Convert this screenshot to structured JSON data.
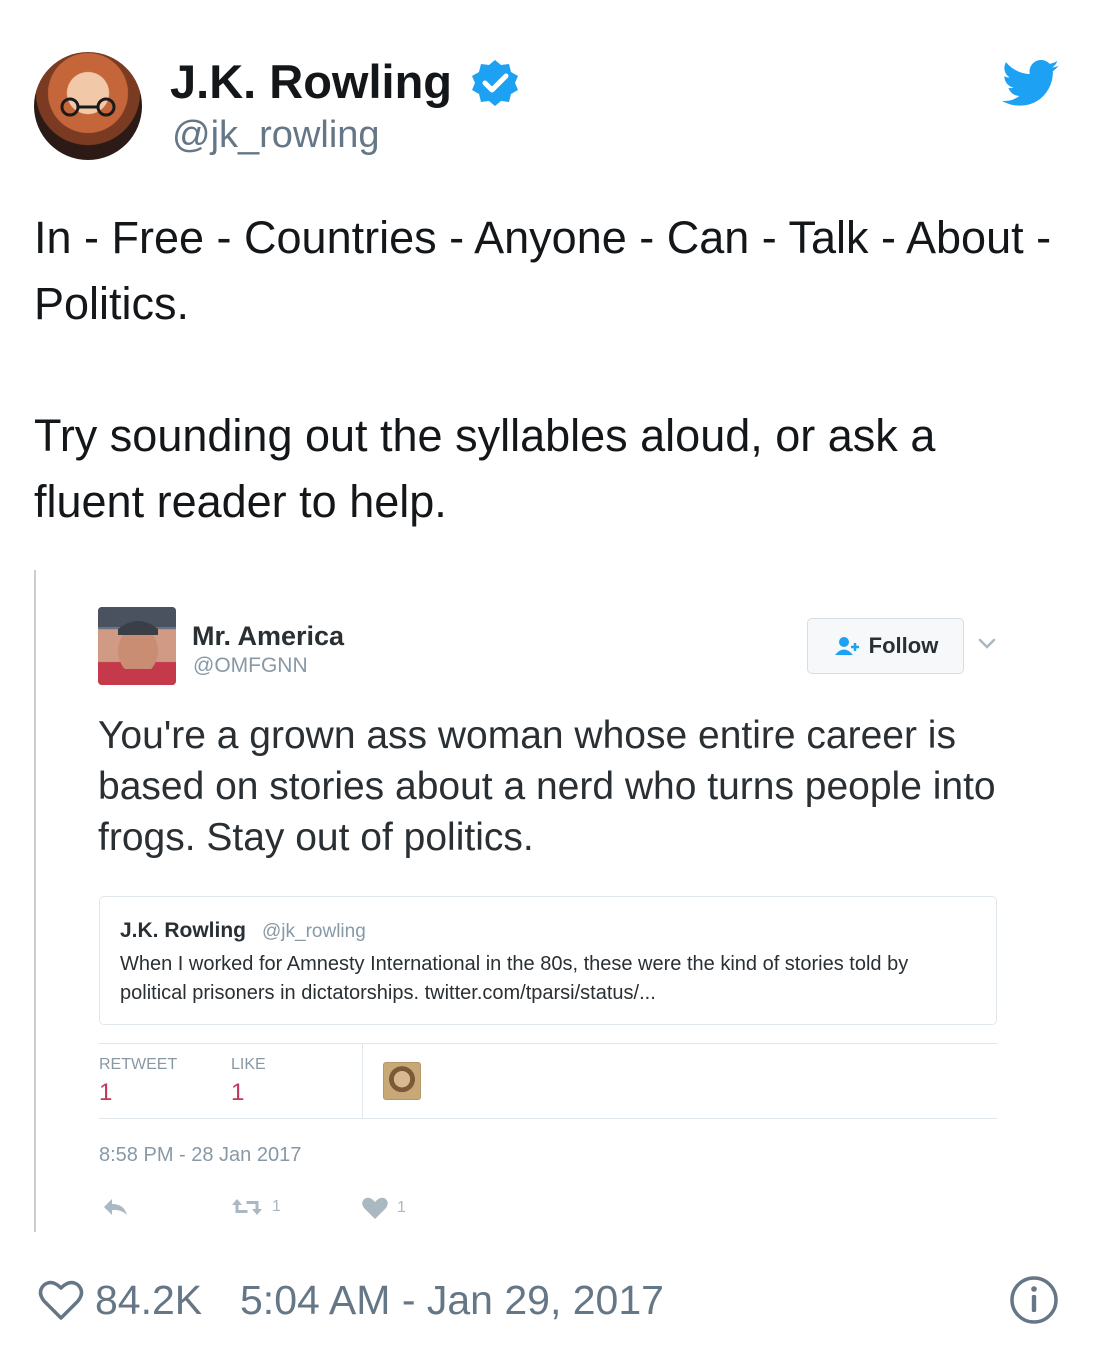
{
  "author": {
    "name": "J.K. Rowling",
    "handle": "@jk_rowling",
    "verified": true
  },
  "tweet": {
    "paragraph1": "In - Free - Countries - Anyone - Can - Talk - About - Politics.",
    "paragraph2": "Try sounding out the syllables aloud, or ask a fluent reader to help."
  },
  "embedded": {
    "author_name": "Mr. America",
    "author_handle": "@OMFGNN",
    "follow_label": "Follow",
    "text": "You're a grown ass woman whose entire career is based on stories about a nerd who turns people into frogs. Stay out of politics.",
    "quoted": {
      "name": "J.K. Rowling",
      "handle": "@jk_rowling",
      "text": "When I worked for Amnesty International in the 80s, these were the kind of stories told by political prisoners in dictatorships. twitter.com/tparsi/status/..."
    },
    "stats": {
      "retweet_label": "RETWEET",
      "retweet_count": "1",
      "like_label": "LIKE",
      "like_count": "1"
    },
    "timestamp": "8:58 PM - 28 Jan 2017",
    "actions": {
      "retweet_count": "1",
      "like_count": "1"
    }
  },
  "footer": {
    "likes": "84.2K",
    "timestamp": "5:04 AM - Jan 29, 2017"
  },
  "colors": {
    "twitter_blue": "#1da1f2",
    "verified_blue": "#1da1f2",
    "secondary_text": "#657786",
    "stat_value": "#c1395a"
  },
  "icons": [
    "verified-badge-icon",
    "twitter-bird-icon",
    "follow-user-icon",
    "chevron-down-icon",
    "reply-icon",
    "retweet-icon",
    "heart-icon",
    "info-icon"
  ]
}
